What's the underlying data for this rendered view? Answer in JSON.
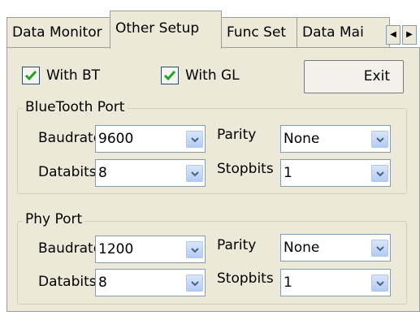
{
  "tabs": [
    "Data Monitor",
    "Other Setup",
    "Func Set",
    "Data Mai"
  ],
  "tab_scroll": {
    "left": "◀",
    "right": "▶"
  },
  "checks": {
    "with_bt": {
      "label": "With BT",
      "checked": true
    },
    "with_gl": {
      "label": "With GL",
      "checked": true
    }
  },
  "exit_label": "Exit",
  "bluetooth": {
    "title": "BlueTooth Port",
    "baud_label": "Baudrate",
    "baud_value": "9600",
    "parity_label": "Parity",
    "parity_value": "None",
    "databits_label": "Databits",
    "databits_value": "8",
    "stopbits_label": "Stopbits",
    "stopbits_value": "1"
  },
  "phy": {
    "title": "Phy Port",
    "baud_label": "Baudrate",
    "baud_value": "1200",
    "parity_label": "Parity",
    "parity_value": "None",
    "databits_label": "Databits",
    "databits_value": "8",
    "stopbits_label": "Stopbits",
    "stopbits_value": "1"
  },
  "colors": {
    "check": "#21a121",
    "combo_border": "#7f9db9",
    "panel": "#ece9d8"
  }
}
